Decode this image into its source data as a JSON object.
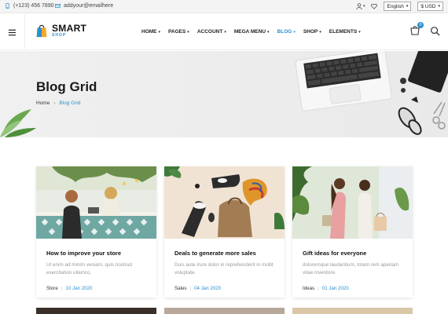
{
  "topbar": {
    "phone": "(+123) 456 7890",
    "email": "addyour@emailhere",
    "language": "English",
    "currency": "$ USD"
  },
  "header": {
    "logo_text": "SMART",
    "logo_sub": "SHOP",
    "nav": [
      {
        "label": "HOME",
        "dropdown": true,
        "active": false
      },
      {
        "label": "PAGES",
        "dropdown": true,
        "active": false
      },
      {
        "label": "ACCOUNT",
        "dropdown": true,
        "active": false
      },
      {
        "label": "MEGA MENU",
        "dropdown": true,
        "active": false
      },
      {
        "label": "BLOG",
        "dropdown": true,
        "active": true
      },
      {
        "label": "SHOP",
        "dropdown": true,
        "active": false
      },
      {
        "label": "ELEMENTS",
        "dropdown": true,
        "active": false
      }
    ],
    "cart_count": "0"
  },
  "hero": {
    "title": "Blog Grid",
    "breadcrumb_home": "Home",
    "breadcrumb_current": "Blog Grid"
  },
  "posts": [
    {
      "title": "How to improve your store",
      "excerpt": "Ut enim ad minim veniam, quis nostrud exercitation ullamco.",
      "category": "Store",
      "date": "10 Jan 2020"
    },
    {
      "title": "Deals to generate more sales",
      "excerpt": "Duis aute irure dolor in reprehenderit in mollit voluptate.",
      "category": "Sales",
      "date": "04 Jan 2020"
    },
    {
      "title": "Gift ideas for everyone",
      "excerpt": "doloremque laudantium, totam rem aperiam vitae inventore.",
      "category": "Ideas",
      "date": "01 Jan 2020"
    }
  ],
  "colors": {
    "accent": "#2a8fd0",
    "logo_orange": "#f5a623"
  },
  "icons": [
    "phone-icon",
    "mail-icon",
    "user-icon",
    "heart-icon",
    "menu-icon",
    "cart-icon",
    "search-icon"
  ]
}
